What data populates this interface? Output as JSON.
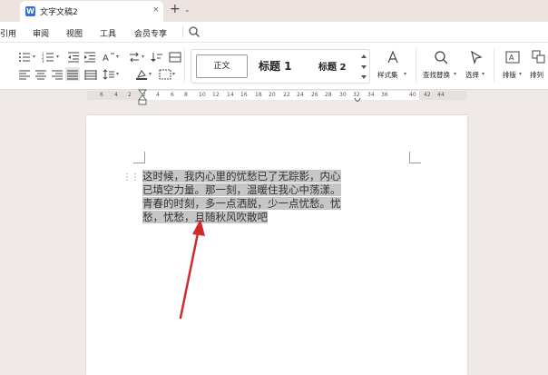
{
  "tab": {
    "app_icon_letter": "W",
    "title": "文字文稿2",
    "close": "×",
    "new_tab": "+",
    "list": "⌄"
  },
  "menu": {
    "items": [
      "引用",
      "审阅",
      "视图",
      "工具",
      "会员专享"
    ]
  },
  "styles": {
    "normal": "正文",
    "h1": "标题 1",
    "h2": "标题 2"
  },
  "toolbar_labels": {
    "style_set": "样式集",
    "find_replace": "查找替换",
    "select": "选择",
    "sort": "排版",
    "arrange": "排列"
  },
  "ruler": [
    "6",
    "4",
    "2",
    "2",
    "4",
    "6",
    "8",
    "10",
    "12",
    "14",
    "16",
    "18",
    "20",
    "22",
    "24",
    "26",
    "28",
    "30",
    "32",
    "34",
    "36",
    "40",
    "42",
    "44"
  ],
  "document": {
    "paragraph_lines": [
      "这时候，我内心里的忧愁已了无踪影，内心",
      "已填空力量。那一刻，温暖住我心中荡漾。",
      "青春的时刻，多一点洒脱，少一点忧愁。忧",
      "愁，忧愁，且随秋风吹散吧"
    ]
  },
  "colors": {
    "accent": "#2f6de1",
    "selection": "#c6c6c6",
    "arrow": "#d12a2a"
  }
}
